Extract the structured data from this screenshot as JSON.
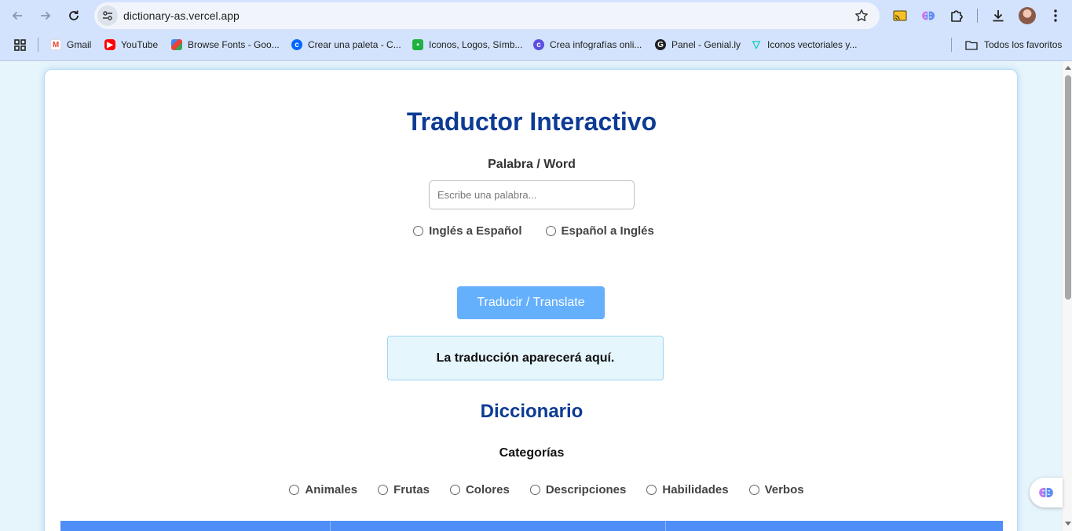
{
  "browser": {
    "url": "dictionary-as.vercel.app",
    "bookmarks": [
      {
        "label": "Gmail",
        "icon": "gmail-icon"
      },
      {
        "label": "YouTube",
        "icon": "youtube-icon"
      },
      {
        "label": "Browse Fonts - Goo...",
        "icon": "google-fonts-icon"
      },
      {
        "label": "Crear una paleta - C...",
        "icon": "coolors-icon"
      },
      {
        "label": "Iconos, Logos, Símb...",
        "icon": "icons8-icon"
      },
      {
        "label": "Crea infografías onli...",
        "icon": "canva-icon"
      },
      {
        "label": "Panel - Genial.ly",
        "icon": "genially-icon"
      },
      {
        "label": "Iconos vectoriales y...",
        "icon": "flaticon-icon"
      }
    ],
    "all_bookmarks": "Todos los favoritos"
  },
  "page": {
    "title": "Traductor Interactivo",
    "word_label": "Palabra / Word",
    "word_input": {
      "placeholder": "Escribe una palabra...",
      "value": ""
    },
    "direction_options": [
      "Inglés a Español",
      "Español a Inglés"
    ],
    "translate_button": "Traducir / Translate",
    "result_text": "La traducción aparecerá aquí.",
    "dictionary_title": "Diccionario",
    "categories_label": "Categorías",
    "categories": [
      "Animales",
      "Frutas",
      "Colores",
      "Descripciones",
      "Habilidades",
      "Verbos"
    ]
  },
  "colors": {
    "title": "#0d3b94",
    "button": "#64b0fc",
    "result_bg": "#e6f6fd",
    "table_header": "#4f8ef7",
    "page_bg": "#e6f4fc"
  }
}
